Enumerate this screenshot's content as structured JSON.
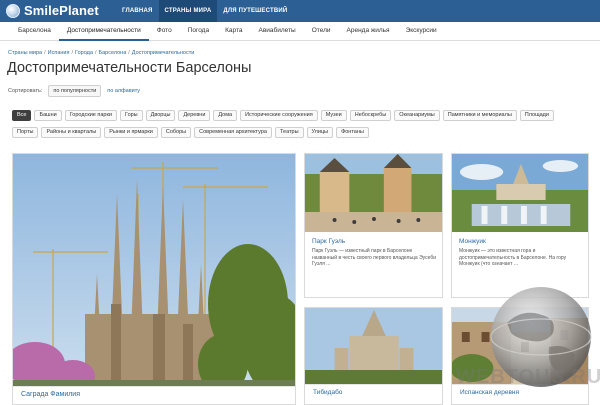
{
  "header": {
    "logo_text": "SmilePlanet",
    "nav": [
      {
        "label": "ГЛАВНАЯ",
        "active": false
      },
      {
        "label": "СТРАНЫ МИРА",
        "active": true
      },
      {
        "label": "ДЛЯ ПУТЕШЕСТВИЙ",
        "active": false
      }
    ]
  },
  "subnav": [
    {
      "label": "Барселона",
      "active": false
    },
    {
      "label": "Достопримечательности",
      "active": true
    },
    {
      "label": "Фото",
      "active": false
    },
    {
      "label": "Погода",
      "active": false
    },
    {
      "label": "Карта",
      "active": false
    },
    {
      "label": "Авиабилеты",
      "active": false
    },
    {
      "label": "Отели",
      "active": false
    },
    {
      "label": "Аренда жилья",
      "active": false
    },
    {
      "label": "Экскурсии",
      "active": false
    }
  ],
  "breadcrumb": [
    "Страны мира",
    "Испания",
    "Города",
    "Барселона",
    "Достопримечательности"
  ],
  "page_title": "Достопримечательности Барселоны",
  "sort": {
    "label": "Сортировать:",
    "by_popularity": "по популярности",
    "by_alphabet": "по алфавиту"
  },
  "filters": {
    "row1": [
      "Все",
      "Башни",
      "Городские парки",
      "Горы",
      "Дворцы",
      "Деревни",
      "Дома",
      "Исторические сооружения",
      "Музеи",
      "Небоскребы",
      "Океанариумы",
      "Памятники и мемориалы",
      "Площади"
    ],
    "row2": [
      "Порты",
      "Районы и кварталы",
      "Рынки и ярмарки",
      "Соборы",
      "Современная архитектура",
      "Театры",
      "Улицы",
      "Фонтаны"
    ],
    "active": "Все"
  },
  "cards": {
    "big": {
      "title": "Саграда Фамилия"
    },
    "c1": {
      "title": "Парк Гуэль",
      "desc": "Парк Гуэль — известный парк в Барселоне названный в честь своего первого владельца Эусеби Гуэля ..."
    },
    "c2": {
      "title": "Монжуик",
      "desc": "Монжуик — это известная гора и достопримечательность в Барселоне. На гору Монжуик (что означает ..."
    },
    "c3": {
      "title": "Тибидабо"
    },
    "c4": {
      "title": "Испанская деревня"
    }
  },
  "watermark": "WEBTOUS.RU",
  "colors": {
    "header": "#2c5f94",
    "link": "#2c6aa0",
    "active_chip": "#3f3f3f"
  }
}
